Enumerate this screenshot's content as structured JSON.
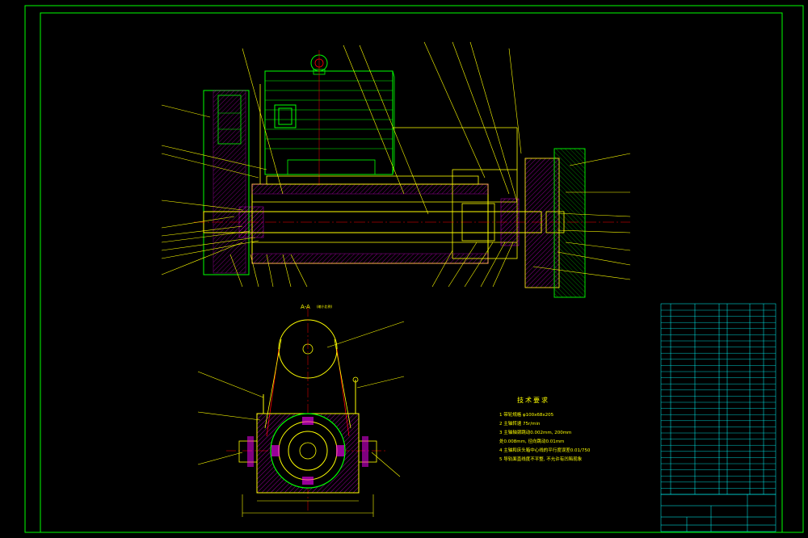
{
  "section_view": {
    "title": "A-A",
    "subtitle": "(缩小比例)"
  },
  "technical_requirements": {
    "title": "技术要求",
    "items": [
      "1  带轮规格 φ100x68x205",
      "2  主轴转速 75r/min",
      "3  主轴轴颈跳动0.002mm, 200mm",
      "处0.008mm, 径向跳动0.01mm",
      "4  主轴和床头箱中心线的平行度误差0.01/750",
      "5  导轨面直线度不平整, 不允许有凹陷现象"
    ]
  },
  "colors": {
    "background": "#000000",
    "border": "#00ff00",
    "outline": "#ffff00",
    "hatch": "#ff00ff",
    "centerline": "#ff0000",
    "table": "#00ffff",
    "dimension": "#ffffff"
  }
}
